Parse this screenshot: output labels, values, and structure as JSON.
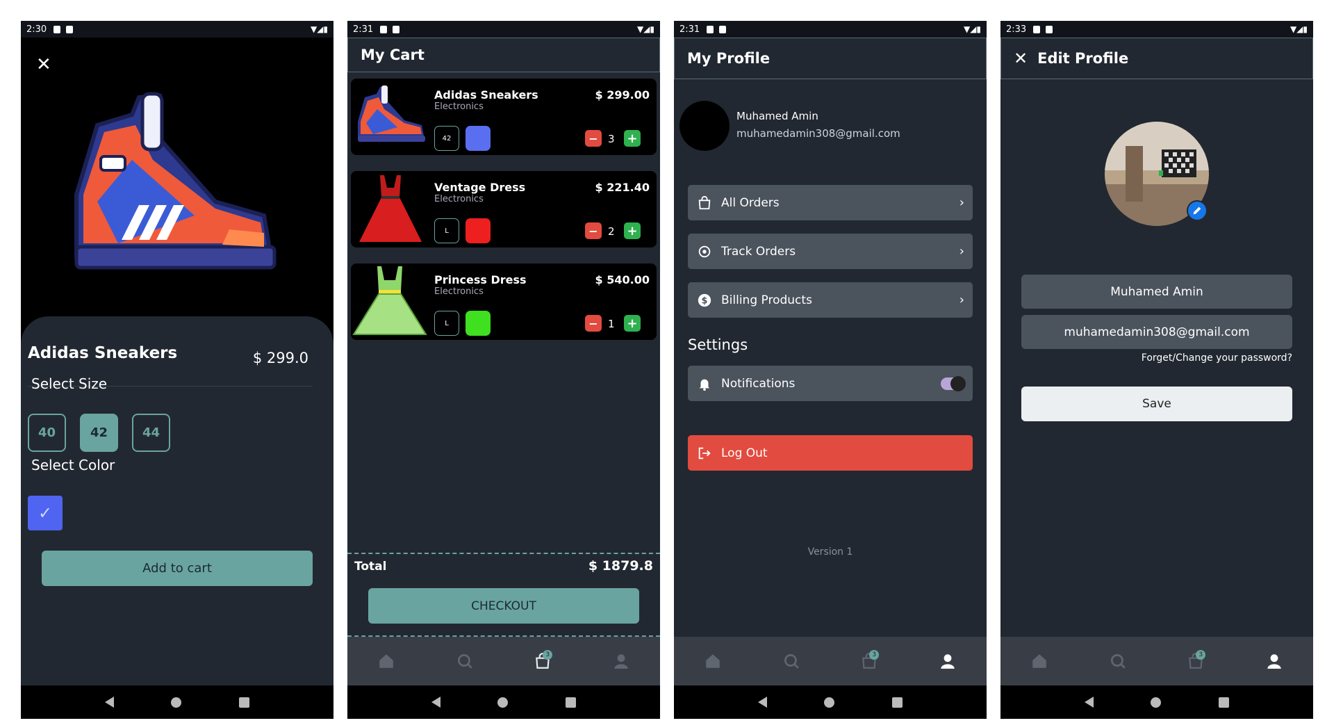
{
  "status": {
    "s1_time": "2:30",
    "s2_time": "2:31",
    "s3_time": "2:31",
    "s4_time": "2:33"
  },
  "product_detail": {
    "name": "Adidas Sneakers",
    "price": "$ 299.0",
    "select_size_label": "Select Size",
    "sizes": [
      "40",
      "42",
      "44"
    ],
    "selected_size": "42",
    "select_color_label": "Select Color",
    "selected_color": "#4f64f0",
    "add_to_cart_label": "Add to cart"
  },
  "cart": {
    "title": "My Cart",
    "items": [
      {
        "name": "Adidas Sneakers",
        "category": "Electronics",
        "price": "$ 299.00",
        "size": "42",
        "color": "#5a6ff0",
        "qty": "3",
        "image": "sneaker"
      },
      {
        "name": "Ventage Dress",
        "category": "Electronics",
        "price": "$ 221.40",
        "size": "L",
        "color": "#ee1f1f",
        "qty": "2",
        "image": "red-dress"
      },
      {
        "name": "Princess Dress",
        "category": "Electronics",
        "price": "$ 540.00",
        "size": "L",
        "color": "#3ee01f",
        "qty": "1",
        "image": "green-dress"
      }
    ],
    "total_label": "Total",
    "total_value": "$ 1879.8",
    "checkout_label": "CHECKOUT",
    "cart_badge": "3"
  },
  "profile": {
    "title": "My Profile",
    "name": "Muhamed Amin",
    "email": "muhamedamin308@gmail.com",
    "menu": [
      {
        "label": "All Orders",
        "icon": "bag-icon"
      },
      {
        "label": "Track Orders",
        "icon": "location-icon"
      },
      {
        "label": "Billing Products",
        "icon": "dollar-icon"
      }
    ],
    "settings_label": "Settings",
    "notifications_label": "Notifications",
    "notifications_on": true,
    "logout_label": "Log Out",
    "version": "Version 1"
  },
  "edit_profile": {
    "title": "Edit Profile",
    "name_value": "Muhamed Amin",
    "email_value": "muhamedamin308@gmail.com",
    "forgot_label": "Forget/Change your password?",
    "save_label": "Save"
  },
  "colors": {
    "accent": "#6aa4a0",
    "background": "#222831",
    "danger": "#e24b3f",
    "plus": "#2fb14f"
  }
}
